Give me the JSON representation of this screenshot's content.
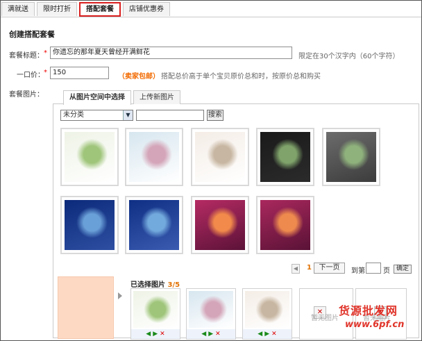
{
  "tabs": [
    {
      "label": "满就送",
      "active": false
    },
    {
      "label": "限时打折",
      "active": false
    },
    {
      "label": "搭配套餐",
      "active": true
    },
    {
      "label": "店铺优惠券",
      "active": false
    }
  ],
  "form": {
    "section_title": "创建搭配套餐",
    "title_label": "套餐标题：",
    "title_value": "你遗忘的那年夏天曾经开满鲜花",
    "title_hint": "限定在30个汉字内（60个字符）",
    "price_label": "一口价：",
    "price_value": "150",
    "price_shipping": "（卖家包邮）",
    "price_hint": "搭配总价高于单个宝贝原价总和时，按原价总和购买",
    "images_label": "套餐图片："
  },
  "image_panel": {
    "tabs": [
      {
        "label": "从图片空间中选择",
        "active": true
      },
      {
        "label": "上传新图片",
        "active": false
      }
    ],
    "category_value": "未分类",
    "search_value": "",
    "search_button": "搜索",
    "thumbnails": [
      {
        "name": "bouquet-frame",
        "colors": [
          "#eef3e6",
          "#9fc57a",
          "#ffffff"
        ]
      },
      {
        "name": "pink-icecream-plate",
        "colors": [
          "#d7e6ef",
          "#d4a5b8",
          "#ffffff"
        ]
      },
      {
        "name": "vintage-dish-frame",
        "colors": [
          "#f4ede6",
          "#c7b6a1",
          "#ffffff"
        ]
      },
      {
        "name": "dark-flower-collage",
        "colors": [
          "#1a1a1a",
          "#7fa36a",
          "#2b2b2b"
        ]
      },
      {
        "name": "grey-photo-collage",
        "colors": [
          "#6c6c6c",
          "#8fb27c",
          "#3c3c3c"
        ]
      },
      {
        "name": "blue-flowers-girl",
        "colors": [
          "#0c2a7a",
          "#6aa0d8",
          "#2e4fa2"
        ]
      },
      {
        "name": "blue-flowers-girl-2",
        "colors": [
          "#0f2f85",
          "#73aadd",
          "#3a5bb0"
        ]
      },
      {
        "name": "sunset-girl",
        "colors": [
          "#b52b63",
          "#f18a4a",
          "#5c1238"
        ]
      },
      {
        "name": "sunset-girl-2",
        "colors": [
          "#a9285d",
          "#ee8a4e",
          "#5a1236"
        ]
      }
    ]
  },
  "pager": {
    "current_page": "1",
    "next_label": "下一页",
    "goto_prefix": "到第",
    "goto_value": "",
    "goto_suffix": "页",
    "confirm_label": "确定"
  },
  "selected": {
    "title": "已选择图片",
    "count": "3/5",
    "items": [
      {
        "name": "bouquet-frame",
        "colors": [
          "#eef3e6",
          "#9fc57a",
          "#ffffff"
        ]
      },
      {
        "name": "pink-icecream-plate",
        "colors": [
          "#d7e6ef",
          "#d4a5b8",
          "#ffffff"
        ]
      },
      {
        "name": "vintage-dish-frame",
        "colors": [
          "#f4ede6",
          "#c7b6a1",
          "#ffffff"
        ]
      }
    ],
    "empty_label": "暂无图片",
    "empty_label_2": "暂无图片"
  },
  "watermark": {
    "line1": "货源批发网",
    "line2": "www.6pf.cn"
  },
  "colors": {
    "accent_orange": "#f26a00",
    "active_tab_border": "#d91e1e",
    "required_star": "#e00000"
  }
}
